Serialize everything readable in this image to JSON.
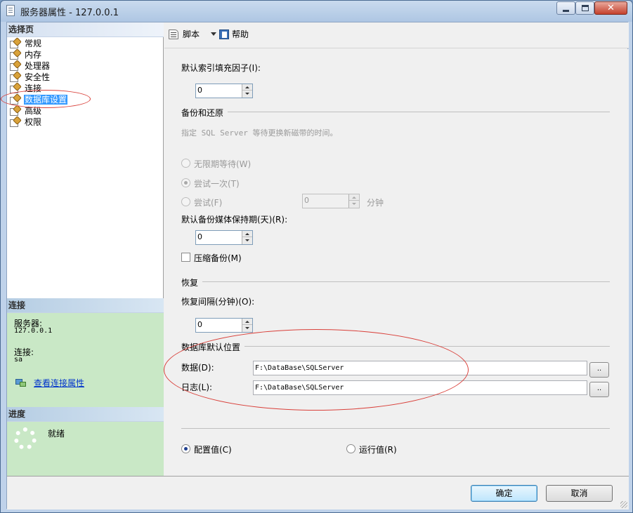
{
  "window": {
    "title": "服务器属性 - 127.0.0.1",
    "controls": {
      "minimize": "",
      "maximize": "",
      "close": "✕"
    }
  },
  "left_pane": {
    "header": "选择页",
    "pages": [
      {
        "label": "常规"
      },
      {
        "label": "内存"
      },
      {
        "label": "处理器"
      },
      {
        "label": "安全性"
      },
      {
        "label": "连接"
      },
      {
        "label": "数据库设置",
        "selected": true
      },
      {
        "label": "高级"
      },
      {
        "label": "权限"
      }
    ],
    "connection": {
      "header": "连接",
      "server_label": "服务器:",
      "server_value": "127.0.0.1",
      "connection_label": "连接:",
      "connection_value": "sa",
      "link": "查看连接属性"
    },
    "progress": {
      "header": "进度",
      "status": "就绪"
    }
  },
  "toolbar": {
    "script": "脚本",
    "help": "帮助"
  },
  "settings": {
    "fill_factor_label": "默认索引填充因子(I):",
    "fill_factor_value": "0",
    "backup_section": "备份和还原",
    "backup_desc": "指定 SQL Server 等待更换新磁带的时间。",
    "radio_wait_indef": "无限期等待(W)",
    "radio_try_once": "尝试一次(T)",
    "radio_try": "尝试(F)",
    "try_minutes_value": "0",
    "minutes_unit": "分钟",
    "retention_label": "默认备份媒体保持期(天)(R):",
    "retention_value": "0",
    "compress_label": "压缩备份(M)",
    "recovery_section": "恢复",
    "recovery_interval_label": "恢复间隔(分钟)(O):",
    "recovery_interval_value": "0",
    "db_location_section": "数据库默认位置",
    "data_label": "数据(D):",
    "data_path": "F:\\DataBase\\SQLServer",
    "log_label": "日志(L):",
    "log_path": "F:\\DataBase\\SQLServer",
    "browse_label": "..",
    "radio_configured": "配置值(C)",
    "radio_running": "运行值(R)"
  },
  "buttons": {
    "ok": "确定",
    "cancel": "取消"
  },
  "colors": {
    "selection": "#3399ff",
    "annotation": "#d9403a",
    "info_panel": "#c9e8c6"
  }
}
